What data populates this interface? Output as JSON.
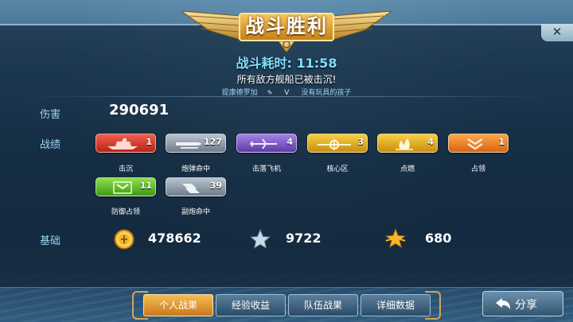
{
  "header": {
    "title": "战斗胜利",
    "battle_time_label": "战斗耗时:",
    "battle_time": "11:58",
    "result_text": "所有敌方舰船已被击沉!",
    "player_left": "提康德罗加",
    "vs": "V",
    "player_right": "没有玩具的孩子"
  },
  "close": {
    "label": "✕"
  },
  "damage": {
    "label": "伤害",
    "value": "290691"
  },
  "achievements": {
    "label": "战绩",
    "items": [
      {
        "label": "击沉",
        "count": "1",
        "color": "red",
        "icon": "ship-icon"
      },
      {
        "label": "炮弹命中",
        "count": "127",
        "color": "grey",
        "icon": "shell-icon"
      },
      {
        "label": "击落飞机",
        "count": "4",
        "color": "purple",
        "icon": "plane-icon"
      },
      {
        "label": "核心区",
        "count": "3",
        "color": "gold",
        "icon": "citadel-icon"
      },
      {
        "label": "点燃",
        "count": "4",
        "color": "orange",
        "icon": "fire-icon"
      },
      {
        "label": "占领",
        "count": "1",
        "color": "orange",
        "icon": "chevron-icon"
      },
      {
        "label": "防御占领",
        "count": "11",
        "color": "green",
        "icon": "defend-icon"
      },
      {
        "label": "副炮命中",
        "count": "39",
        "color": "grey",
        "icon": "secondary-icon"
      }
    ]
  },
  "basic": {
    "label": "基础",
    "coins": "478662",
    "xp": "9722",
    "commander_xp": "680"
  },
  "tabs": [
    {
      "label": "个人战果",
      "active": true
    },
    {
      "label": "经验收益",
      "active": false
    },
    {
      "label": "队伍战果",
      "active": false
    },
    {
      "label": "详细数据",
      "active": false
    }
  ],
  "share": {
    "label": "分享"
  }
}
